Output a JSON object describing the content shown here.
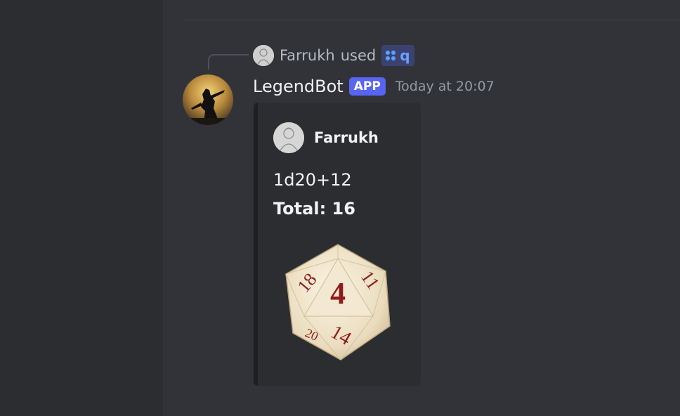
{
  "reply": {
    "user": "Farrukh",
    "used_text": "used",
    "command_label": "q"
  },
  "message": {
    "bot_name": "LegendBot",
    "badge": "APP",
    "timestamp": "Today at 20:07"
  },
  "embed": {
    "author": "Farrukh",
    "roll": "1d20+12",
    "total": "Total: 16",
    "image_icon": "d20-dice-icon"
  },
  "colors": {
    "background": "#313338",
    "sidebar": "#2b2d31",
    "badge": "#5865f2",
    "command_chip": "#3c4270"
  }
}
